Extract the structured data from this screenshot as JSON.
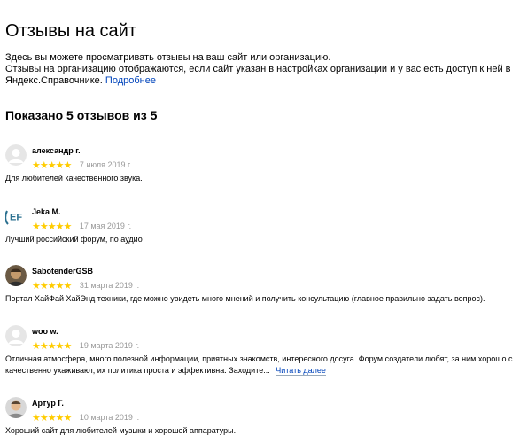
{
  "page": {
    "title": "Отзывы на сайт",
    "intro_line1": "Здесь вы можете просматривать отзывы на ваш сайт или организацию.",
    "intro_line2": "Отзывы на организацию отображаются, если сайт указан в настройках организации и у вас есть доступ к ней в Яндекс.Справочнике.",
    "more_link": "Подробнее",
    "count_heading": "Показано 5 отзывов из 5"
  },
  "colors": {
    "star": "#ffcc00",
    "link": "#0044bb",
    "date": "#999999"
  },
  "reviews": [
    {
      "author": "александр г.",
      "rating": 5,
      "date": "7 июля 2019 г.",
      "text": "Для любителей качественного звука.",
      "avatar": "default-user-icon"
    },
    {
      "author": "Jeka M.",
      "rating": 5,
      "date": "17 мая 2019 г.",
      "text": "Лучший российский форум, по аудио",
      "avatar": "ef-logo"
    },
    {
      "author": "SabotenderGSB",
      "rating": 5,
      "date": "31 марта 2019 г.",
      "text": "Портал ХайФай ХайЭнд техники, где можно увидеть много мнений и получить консультацию (главное правильно задать вопрос).",
      "avatar": "photo"
    },
    {
      "author": "woo w.",
      "rating": 5,
      "date": "19 марта 2019 г.",
      "text": "Отличная атмосфера, много полезной информации, приятных знакомств, интересного досуга. Форум создатели любят, за ним хорошо с",
      "text_line2": "качественно ухаживают, их политика проста и эффективна. Заходите...",
      "read_more": "Читать далее",
      "avatar": "default-user-icon"
    },
    {
      "author": "Артур Г.",
      "rating": 5,
      "date": "10 марта 2019 г.",
      "text": "Хороший сайт для любителей музыки и хорошей аппаратуры.",
      "avatar": "photo"
    }
  ]
}
